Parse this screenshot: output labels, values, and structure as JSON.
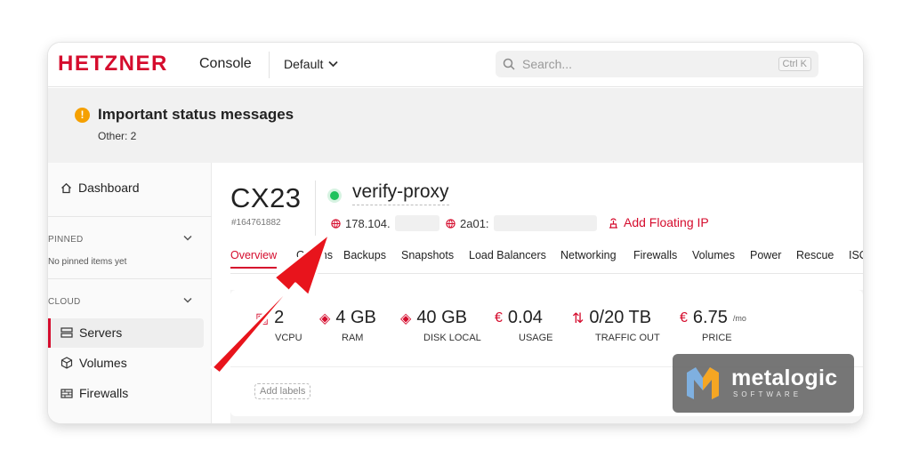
{
  "topbar": {
    "logo": "HETZNER",
    "app_name": "Console",
    "project": "Default",
    "search_placeholder": "Search...",
    "search_shortcut": "Ctrl K"
  },
  "status": {
    "title": "Important status messages",
    "subtitle": "Other:  2"
  },
  "sidebar": {
    "dashboard": "Dashboard",
    "pinned_header": "PINNED",
    "pinned_empty": "No pinned items yet",
    "cloud_header": "CLOUD",
    "items": [
      {
        "label": "Servers",
        "icon": "server-icon",
        "active": true
      },
      {
        "label": "Volumes",
        "icon": "cube-icon",
        "active": false
      },
      {
        "label": "Firewalls",
        "icon": "firewall-icon",
        "active": false
      }
    ]
  },
  "server": {
    "type": "CX23",
    "id": "#164761882",
    "name": "verify-proxy",
    "status_color": "#1fc25d",
    "ipv4": "178.104.",
    "ipv6": "2a01:",
    "floating_ip": "Add Floating IP"
  },
  "tabs": [
    "Overview",
    "Graphs",
    "Backups",
    "Snapshots",
    "Load Balancers",
    "Networking",
    "Firewalls",
    "Volumes",
    "Power",
    "Rescue",
    "ISO"
  ],
  "active_tab": "Overview",
  "stats": [
    {
      "value": "2",
      "unit": "",
      "label": "VCPU",
      "icon": "cpu-icon"
    },
    {
      "value": "4 GB",
      "unit": "",
      "label": "RAM",
      "icon": "memory-icon"
    },
    {
      "value": "40 GB",
      "unit": "",
      "label": "DISK LOCAL",
      "icon": "disk-icon"
    },
    {
      "value": "0.04",
      "unit": "",
      "label": "USAGE",
      "icon": "euro-icon"
    },
    {
      "value": "0/20 TB",
      "unit": "",
      "label": "TRAFFIC OUT",
      "icon": "traffic-icon"
    },
    {
      "value": "6.75",
      "unit": "/mo",
      "label": "PRICE",
      "icon": "euro-icon"
    }
  ],
  "add_labels": "Add labels",
  "watermark": {
    "name": "metalogic",
    "sub": "SOFTWARE"
  },
  "colors": {
    "brand": "#d50c2d",
    "annotation_arrow": "#e8141c",
    "status_online": "#1fc25d"
  }
}
